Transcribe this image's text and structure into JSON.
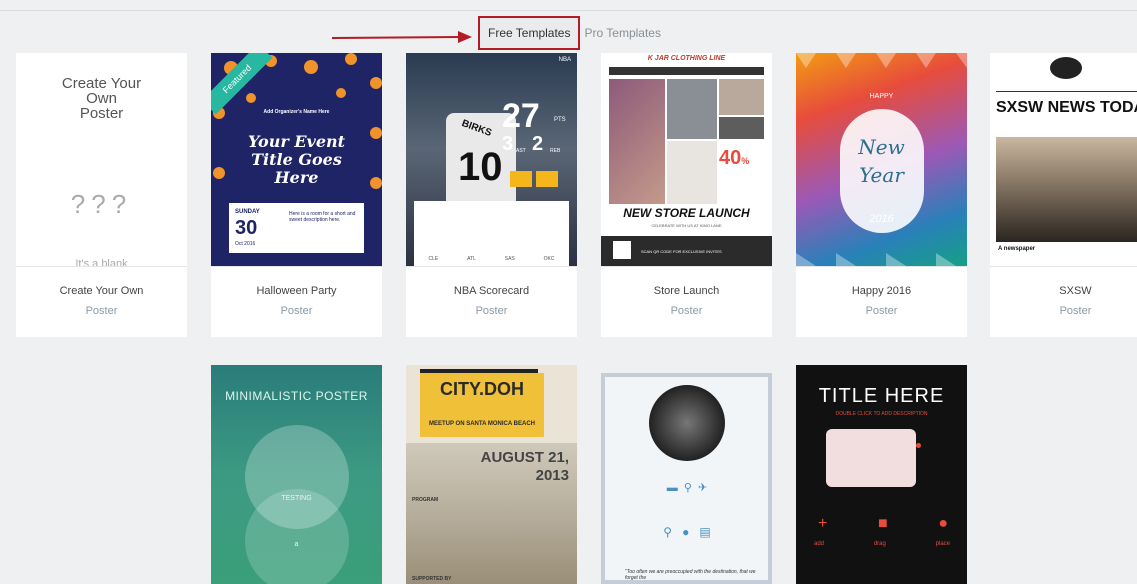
{
  "tabs": [
    {
      "label": "Free Templates",
      "active": true
    },
    {
      "label": "Pro Templates",
      "active": false
    }
  ],
  "blank_card": {
    "title": "Create Your\nOwn\nPoster",
    "note": "It's a blank"
  },
  "cards": [
    {
      "name": "Create Your Own",
      "type": "Poster"
    },
    {
      "name": "Halloween Party",
      "type": "Poster"
    },
    {
      "name": "NBA Scorecard",
      "type": "Poster"
    },
    {
      "name": "Store Launch",
      "type": "Poster"
    },
    {
      "name": "Happy 2016",
      "type": "Poster"
    },
    {
      "name": "SXSW",
      "type": "Poster"
    }
  ],
  "halloween": {
    "badge": "Featured",
    "organizer": "Add Organizer's Name Here",
    "title": "Your Event Title Goes Here",
    "day": "SUNDAY",
    "date": "30",
    "month": "Oct 2016",
    "desc": "Here is a room for a short and sweet description here."
  },
  "nba": {
    "logo": "NBA",
    "name": "BIRKS",
    "number": "10",
    "pts": "27",
    "ast": "3",
    "reb": "2",
    "pts_label": "PTS",
    "ast_label": "AST",
    "reb_label": "REB",
    "teams": [
      "CLE",
      "ATL",
      "SAS",
      "OKC"
    ]
  },
  "store": {
    "brand": "K JAR CLOTHING LINE",
    "discount": "40",
    "discount_pct": "%",
    "headline": "NEW STORE LAUNCH",
    "sub": "CELEBRATE WITH US AT KIMO LANE",
    "qr_note": "SCAN QR CODE FOR EXCLUSIVE INVITES"
  },
  "happy": {
    "word1": "New",
    "word2": "Year",
    "top": "HAPPY",
    "year": "2016"
  },
  "sxsw": {
    "headline": "SXSW NEWS TODAY",
    "caption": "A newspaper"
  },
  "row2": {
    "minimal": {
      "title": "MINIMALISTIC POSTER",
      "mid": "TESTING",
      "a": "a"
    },
    "city": {
      "title": "CITY.DOH",
      "sub": "MEETUP ON SANTA MONICA BEACH",
      "date": "AUGUST 21,",
      "year": "2013",
      "program": "PROGRAM",
      "support": "SUPPORTED BY"
    },
    "camera": {
      "quote": "\"Too often we are preoccupied with the destination, that we forget the"
    },
    "title_here": {
      "title": "TITLE HERE",
      "sub": "DOUBLE CLICK TO ADD DESCRIPTION",
      "actions": [
        "add",
        "drag",
        "place"
      ]
    }
  }
}
